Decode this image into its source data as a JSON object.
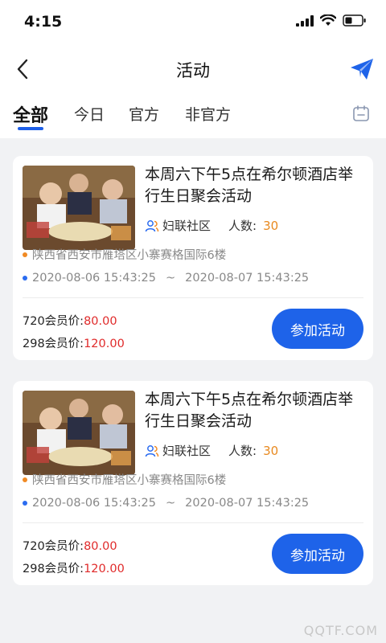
{
  "status_bar": {
    "time": "4:15"
  },
  "nav": {
    "title": "活动"
  },
  "tabs": [
    {
      "label": "全部",
      "active": true
    },
    {
      "label": "今日",
      "active": false
    },
    {
      "label": "官方",
      "active": false
    },
    {
      "label": "非官方",
      "active": false
    }
  ],
  "activities": [
    {
      "title": "本周六下午5点在希尔顿酒店举行生日聚会活动",
      "organizer": "妇联社区",
      "count_label": "人数:",
      "count": "30",
      "address": "陕西省西安市雁塔区小寨赛格国际6楼",
      "start_time": "2020-08-06 15:43:25",
      "separator": "~",
      "end_time": "2020-08-07 15:43:25",
      "price_720_label": "720会员价:",
      "price_720": "80.00",
      "price_298_label": "298会员价:",
      "price_298": "120.00",
      "join_label": "参加活动"
    },
    {
      "title": "本周六下午5点在希尔顿酒店举行生日聚会活动",
      "organizer": "妇联社区",
      "count_label": "人数:",
      "count": "30",
      "address": "陕西省西安市雁塔区小寨赛格国际6楼",
      "start_time": "2020-08-06 15:43:25",
      "separator": "~",
      "end_time": "2020-08-07 15:43:25",
      "price_720_label": "720会员价:",
      "price_720": "80.00",
      "price_298_label": "298会员价:",
      "price_298": "120.00",
      "join_label": "参加活动"
    }
  ],
  "watermark": "QQTF.COM",
  "colors": {
    "accent": "#1e63e9",
    "price": "#e02a2a",
    "count": "#e8891f"
  },
  "icons": [
    "signal-icon",
    "wifi-icon",
    "battery-icon",
    "back-icon",
    "send-icon",
    "calendar-icon",
    "people-icon"
  ]
}
